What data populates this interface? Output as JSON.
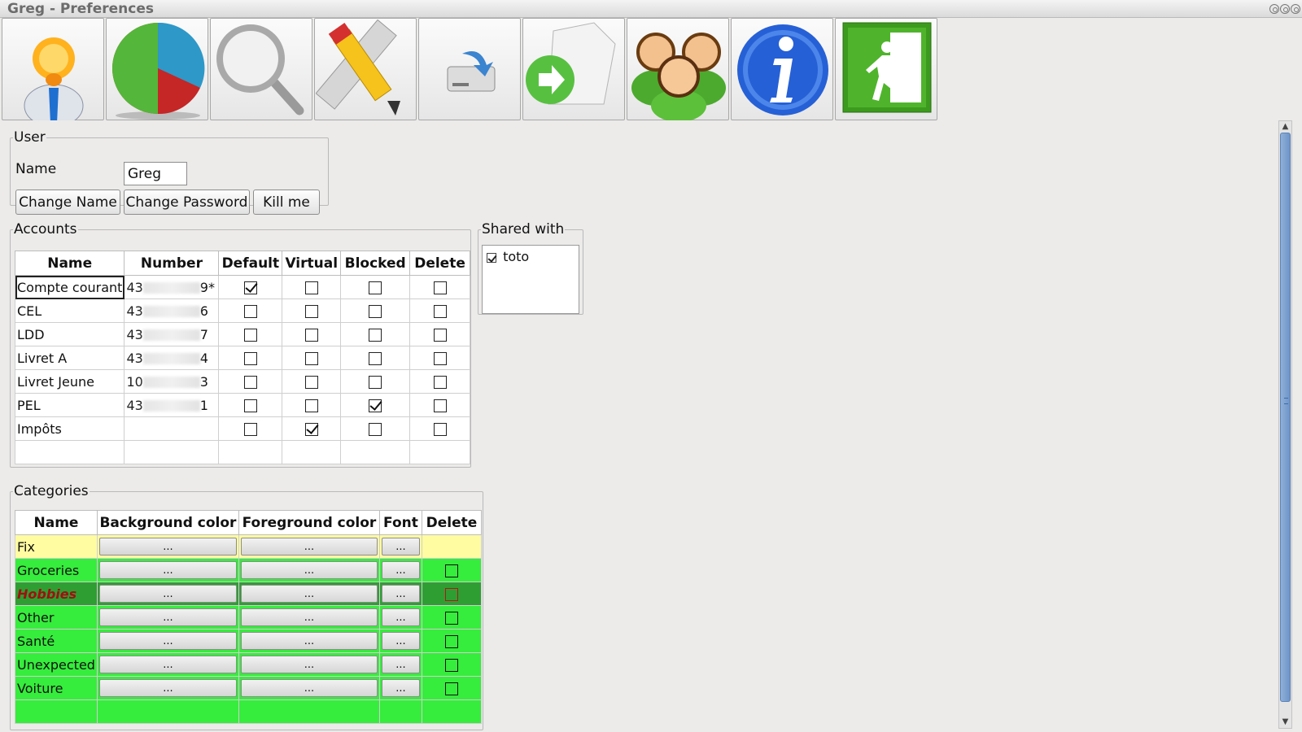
{
  "window": {
    "title": "Greg - Preferences"
  },
  "toolbar": {
    "buttons": [
      {
        "icon": "user-icon"
      },
      {
        "icon": "pie-chart-icon"
      },
      {
        "icon": "search-icon"
      },
      {
        "icon": "pencil-ruler-icon"
      },
      {
        "icon": "import-drive-icon"
      },
      {
        "icon": "export-document-icon"
      },
      {
        "icon": "users-group-icon"
      },
      {
        "icon": "info-icon"
      },
      {
        "icon": "exit-icon"
      }
    ]
  },
  "user": {
    "legend": "User",
    "name_label": "Name",
    "name_value": "Greg",
    "change_name": "Change Name",
    "change_password": "Change Password",
    "kill_me": "Kill me"
  },
  "accounts": {
    "legend": "Accounts",
    "columns": [
      "Name",
      "Number",
      "Default",
      "Virtual",
      "Blocked",
      "Delete"
    ],
    "rows": [
      {
        "name": "Compte courant",
        "num_prefix": "43",
        "num_suffix": "9*",
        "default": true,
        "virtual": false,
        "blocked": false,
        "delete": false
      },
      {
        "name": "CEL",
        "num_prefix": "43",
        "num_suffix": "6",
        "default": false,
        "virtual": false,
        "blocked": false,
        "delete": false
      },
      {
        "name": "LDD",
        "num_prefix": "43",
        "num_suffix": "7",
        "default": false,
        "virtual": false,
        "blocked": false,
        "delete": false
      },
      {
        "name": "Livret A",
        "num_prefix": "43",
        "num_suffix": "4",
        "default": false,
        "virtual": false,
        "blocked": false,
        "delete": false
      },
      {
        "name": "Livret Jeune",
        "num_prefix": "10",
        "num_suffix": "3",
        "default": false,
        "virtual": false,
        "blocked": false,
        "delete": false
      },
      {
        "name": "PEL",
        "num_prefix": "43",
        "num_suffix": "1",
        "default": false,
        "virtual": false,
        "blocked": true,
        "delete": false
      },
      {
        "name": "Impôts",
        "num_prefix": "",
        "num_suffix": "",
        "default": false,
        "virtual": true,
        "blocked": false,
        "delete": false
      }
    ]
  },
  "shared": {
    "legend": "Shared with",
    "items": [
      {
        "label": "toto",
        "checked": true
      }
    ]
  },
  "categories": {
    "legend": "Categories",
    "columns": [
      "Name",
      "Background color",
      "Foreground color",
      "Font",
      "Delete"
    ],
    "button_label": "...",
    "rows": [
      {
        "name": "Fix",
        "style": "fix"
      },
      {
        "name": "Groceries",
        "style": "normal"
      },
      {
        "name": "Hobbies",
        "style": "sel"
      },
      {
        "name": "Other",
        "style": "normal"
      },
      {
        "name": "Santé",
        "style": "normal"
      },
      {
        "name": "Unexpected",
        "style": "normal"
      },
      {
        "name": "Voiture",
        "style": "normal"
      }
    ],
    "colors": {
      "row_green": "#36ec3c",
      "row_yellow": "#fffca1",
      "selected_green": "#2e9e32",
      "hobbies_text": "#a01010"
    }
  }
}
